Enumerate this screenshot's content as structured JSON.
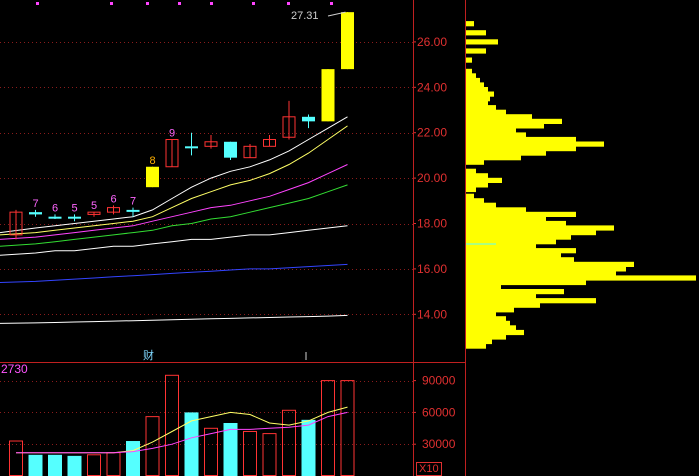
{
  "chart_data": [
    {
      "type": "candlestick",
      "y_axis": {
        "ticks": [
          "14.00",
          "16.00",
          "18.00",
          "20.00",
          "22.00",
          "24.00",
          "26.00"
        ],
        "ylim": [
          12.5,
          27.6
        ]
      },
      "high_label": "27.31",
      "note": "财",
      "candles": [
        {
          "o": 17.5,
          "c": 18.5,
          "h": 18.6,
          "l": 17.3,
          "color": "red",
          "mark": ""
        },
        {
          "o": 18.5,
          "c": 18.4,
          "h": 18.6,
          "l": 18.3,
          "color": "cyan",
          "mark": "7"
        },
        {
          "o": 18.3,
          "c": 18.3,
          "h": 18.4,
          "l": 18.2,
          "color": "cyan",
          "mark": "6"
        },
        {
          "o": 18.3,
          "c": 18.3,
          "h": 18.4,
          "l": 18.1,
          "color": "cyan",
          "mark": "5"
        },
        {
          "o": 18.4,
          "c": 18.5,
          "h": 18.5,
          "l": 18.3,
          "color": "red",
          "mark": "5"
        },
        {
          "o": 18.5,
          "c": 18.7,
          "h": 18.8,
          "l": 18.4,
          "color": "red",
          "mark": "6"
        },
        {
          "o": 18.6,
          "c": 18.6,
          "h": 18.7,
          "l": 18.3,
          "color": "cyan",
          "mark": "7"
        },
        {
          "o": 19.6,
          "c": 20.5,
          "h": 20.5,
          "l": 19.6,
          "color": "yellow",
          "mark": "8"
        },
        {
          "o": 20.5,
          "c": 21.7,
          "h": 21.7,
          "l": 20.5,
          "color": "red",
          "mark": "9"
        },
        {
          "o": 21.4,
          "c": 21.4,
          "h": 22.0,
          "l": 21.0,
          "color": "cyan",
          "mark": ""
        },
        {
          "o": 21.4,
          "c": 21.6,
          "h": 21.9,
          "l": 21.3,
          "color": "red",
          "mark": ""
        },
        {
          "o": 21.6,
          "c": 20.9,
          "h": 21.6,
          "l": 20.8,
          "color": "cyan",
          "mark": ""
        },
        {
          "o": 20.9,
          "c": 21.4,
          "h": 21.5,
          "l": 20.9,
          "color": "red",
          "mark": ""
        },
        {
          "o": 21.4,
          "c": 21.7,
          "h": 21.9,
          "l": 21.4,
          "color": "red",
          "mark": ""
        },
        {
          "o": 21.8,
          "c": 22.7,
          "h": 23.4,
          "l": 21.7,
          "color": "red",
          "mark": ""
        },
        {
          "o": 22.7,
          "c": 22.5,
          "h": 22.8,
          "l": 22.2,
          "color": "cyan",
          "mark": ""
        },
        {
          "o": 22.5,
          "c": 24.8,
          "h": 24.8,
          "l": 22.5,
          "color": "yellow",
          "mark": ""
        },
        {
          "o": 24.8,
          "c": 27.31,
          "h": 27.31,
          "l": 24.8,
          "color": "yellow",
          "mark": ""
        }
      ],
      "moving_averages": [
        {
          "color": "#ffffff",
          "values": [
            17.6,
            17.8,
            17.9,
            18.0,
            18.1,
            18.2,
            18.3,
            18.6,
            19.1,
            19.6,
            20.0,
            20.3,
            20.5,
            20.8,
            21.2,
            21.7,
            22.2,
            22.7
          ]
        },
        {
          "color": "#ffff66",
          "values": [
            17.5,
            17.6,
            17.7,
            17.8,
            17.9,
            18.0,
            18.1,
            18.3,
            18.7,
            19.1,
            19.4,
            19.7,
            19.9,
            20.2,
            20.6,
            21.1,
            21.7,
            22.3
          ]
        },
        {
          "color": "#ff44ff",
          "values": [
            17.3,
            17.4,
            17.5,
            17.6,
            17.7,
            17.8,
            17.9,
            18.1,
            18.3,
            18.5,
            18.7,
            18.8,
            19.0,
            19.2,
            19.5,
            19.8,
            20.2,
            20.6
          ]
        },
        {
          "color": "#33dd33",
          "values": [
            17.0,
            17.1,
            17.2,
            17.3,
            17.4,
            17.5,
            17.6,
            17.7,
            17.9,
            18.0,
            18.2,
            18.3,
            18.5,
            18.7,
            18.9,
            19.1,
            19.4,
            19.7
          ]
        },
        {
          "color": "#ffffff",
          "values": [
            16.6,
            16.7,
            16.8,
            16.8,
            16.9,
            17.0,
            17.0,
            17.1,
            17.2,
            17.3,
            17.3,
            17.4,
            17.5,
            17.5,
            17.6,
            17.7,
            17.8,
            17.9
          ]
        },
        {
          "color": "#3344ff",
          "values": [
            15.4,
            15.45,
            15.5,
            15.55,
            15.6,
            15.65,
            15.7,
            15.75,
            15.8,
            15.85,
            15.9,
            15.95,
            16.0,
            16.0,
            16.05,
            16.1,
            16.15,
            16.2
          ]
        },
        {
          "color": "#ffffff",
          "values": [
            13.6,
            13.62,
            13.64,
            13.66,
            13.68,
            13.7,
            13.72,
            13.74,
            13.76,
            13.78,
            13.8,
            13.82,
            13.84,
            13.86,
            13.88,
            13.9,
            13.92,
            13.95
          ]
        }
      ]
    },
    {
      "type": "bar",
      "label": "2730",
      "multiplier": "X10",
      "y_axis": {
        "ticks": [
          "30000",
          "60000",
          "90000"
        ],
        "ylim": [
          0,
          100000
        ]
      },
      "values": [
        33000,
        20000,
        20000,
        19000,
        20000,
        22000,
        33000,
        56000,
        95000,
        60000,
        45000,
        50000,
        42000,
        40000,
        62000,
        53000,
        90000,
        90000
      ],
      "colors": [
        "red",
        "cyan",
        "cyan",
        "cyan",
        "red",
        "red",
        "cyan",
        "red",
        "red",
        "cyan",
        "red",
        "cyan",
        "red",
        "red",
        "red",
        "cyan",
        "red",
        "red"
      ],
      "ma_lines": [
        {
          "color": "#ffff66",
          "values": [
            22000,
            22000,
            22000,
            22000,
            22000,
            22000,
            24000,
            32000,
            42000,
            52000,
            56000,
            60000,
            58000,
            50000,
            48000,
            52000,
            60000,
            65000
          ]
        },
        {
          "color": "#ff44ff",
          "values": [
            22000,
            22000,
            22000,
            22000,
            22000,
            22000,
            23000,
            26000,
            30000,
            36000,
            40000,
            44000,
            44000,
            45000,
            46000,
            48000,
            56000,
            60000
          ]
        }
      ]
    },
    {
      "type": "histogram",
      "orientation": "horizontal",
      "levels": [
        {
          "price": 12.6,
          "len": 20
        },
        {
          "price": 12.8,
          "len": 26
        },
        {
          "price": 13.0,
          "len": 40
        },
        {
          "price": 13.2,
          "len": 58
        },
        {
          "price": 13.4,
          "len": 50
        },
        {
          "price": 13.6,
          "len": 44
        },
        {
          "price": 13.8,
          "len": 40
        },
        {
          "price": 14.0,
          "len": 30
        },
        {
          "price": 14.2,
          "len": 48
        },
        {
          "price": 14.4,
          "len": 74
        },
        {
          "price": 14.6,
          "len": 130
        },
        {
          "price": 14.8,
          "len": 70
        },
        {
          "price": 15.0,
          "len": 98
        },
        {
          "price": 15.2,
          "len": 35
        },
        {
          "price": 15.4,
          "len": 120
        },
        {
          "price": 15.6,
          "len": 230
        },
        {
          "price": 15.8,
          "len": 150
        },
        {
          "price": 16.0,
          "len": 160
        },
        {
          "price": 16.2,
          "len": 168
        },
        {
          "price": 16.4,
          "len": 108
        },
        {
          "price": 16.6,
          "len": 95
        },
        {
          "price": 16.8,
          "len": 110
        },
        {
          "price": 17.0,
          "len": 70
        },
        {
          "price": 17.2,
          "len": 90
        },
        {
          "price": 17.4,
          "len": 105
        },
        {
          "price": 17.6,
          "len": 130
        },
        {
          "price": 17.8,
          "len": 148
        },
        {
          "price": 18.0,
          "len": 100
        },
        {
          "price": 18.2,
          "len": 80
        },
        {
          "price": 18.4,
          "len": 110
        },
        {
          "price": 18.6,
          "len": 60
        },
        {
          "price": 18.8,
          "len": 30
        },
        {
          "price": 19.0,
          "len": 18
        },
        {
          "price": 19.2,
          "len": 8
        },
        {
          "price": 19.5,
          "len": 10
        },
        {
          "price": 19.7,
          "len": 22
        },
        {
          "price": 19.9,
          "len": 36
        },
        {
          "price": 20.1,
          "len": 22
        },
        {
          "price": 20.3,
          "len": 10
        },
        {
          "price": 20.7,
          "len": 18
        },
        {
          "price": 20.9,
          "len": 55
        },
        {
          "price": 21.1,
          "len": 80
        },
        {
          "price": 21.3,
          "len": 110
        },
        {
          "price": 21.5,
          "len": 138
        },
        {
          "price": 21.7,
          "len": 110
        },
        {
          "price": 21.9,
          "len": 60
        },
        {
          "price": 22.1,
          "len": 50
        },
        {
          "price": 22.3,
          "len": 78
        },
        {
          "price": 22.5,
          "len": 96
        },
        {
          "price": 22.7,
          "len": 66
        },
        {
          "price": 22.9,
          "len": 40
        },
        {
          "price": 23.1,
          "len": 30
        },
        {
          "price": 23.3,
          "len": 22
        },
        {
          "price": 23.5,
          "len": 24
        },
        {
          "price": 23.7,
          "len": 28
        },
        {
          "price": 23.9,
          "len": 22
        },
        {
          "price": 24.1,
          "len": 18
        },
        {
          "price": 24.3,
          "len": 14
        },
        {
          "price": 24.5,
          "len": 10
        },
        {
          "price": 24.7,
          "len": 6
        },
        {
          "price": 25.2,
          "len": 6
        },
        {
          "price": 25.6,
          "len": 20
        },
        {
          "price": 26.0,
          "len": 32
        },
        {
          "price": 26.4,
          "len": 20
        },
        {
          "price": 26.8,
          "len": 8
        }
      ]
    }
  ]
}
